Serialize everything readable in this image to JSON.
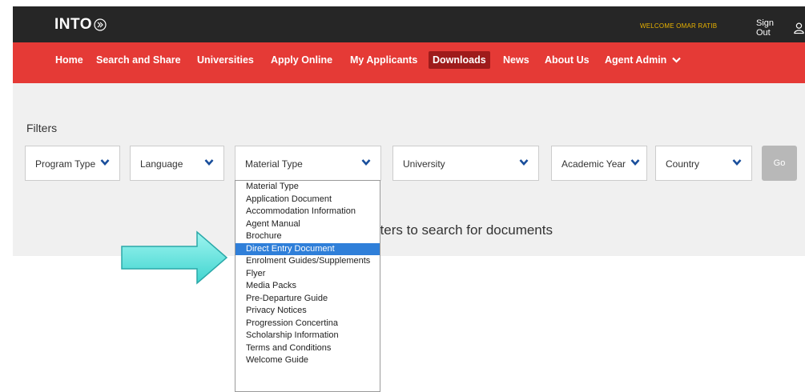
{
  "header": {
    "logo_text": "INTO",
    "welcome": "WELCOME OMAR RATIB",
    "sign_out": "Sign Out"
  },
  "nav": {
    "items": [
      {
        "label": "Home"
      },
      {
        "label": "Search and Share"
      },
      {
        "label": "Universities"
      },
      {
        "label": "Apply Online"
      },
      {
        "label": "My Applicants"
      },
      {
        "label": "Downloads",
        "active": true
      },
      {
        "label": "News"
      },
      {
        "label": "About Us"
      },
      {
        "label": "Agent Admin"
      }
    ]
  },
  "filters": {
    "title": "Filters",
    "selects": [
      {
        "label": "Program Type"
      },
      {
        "label": "Language"
      },
      {
        "label": "Material Type"
      },
      {
        "label": "University"
      },
      {
        "label": "Academic Year"
      },
      {
        "label": "Country"
      }
    ],
    "go_label": "Go"
  },
  "message": "ilters to search for documents",
  "material_dropdown": {
    "options": [
      "Material Type",
      "Application Document",
      "Accommodation Information",
      "Agent Manual",
      "Brochure",
      "Direct Entry Document",
      "Enrolment Guides/Supplements",
      "Flyer",
      "Media Packs",
      "Pre-Departure Guide",
      "Privacy Notices",
      "Progression Concertina",
      "Scholarship Information",
      "Terms and Conditions",
      "Welcome Guide"
    ],
    "highlighted": "Direct Entry Document"
  },
  "colors": {
    "topbar": "#262626",
    "navbar": "#e53a36",
    "nav_active": "#9e1b1b",
    "welcome_text": "#e8b200",
    "dropdown_highlight": "#2f7fd9",
    "arrow_fill": "#5de8e0"
  },
  "icons": {
    "logo_mark": "double-chevron-circle-icon",
    "sign_out": "user-outline-icon",
    "select_chevron": "chevron-down-icon",
    "annotation": "right-arrow-icon"
  }
}
